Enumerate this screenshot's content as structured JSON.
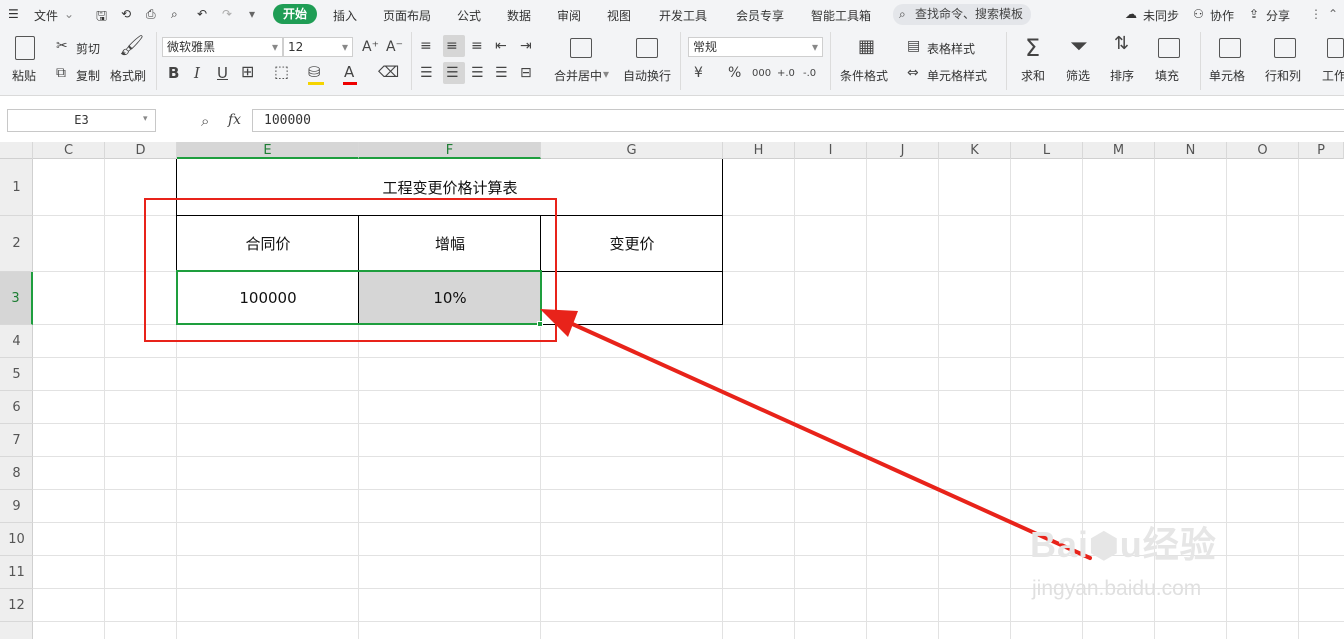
{
  "menubar": {
    "file_label": "文件",
    "tabs": [
      "开始",
      "插入",
      "页面布局",
      "公式",
      "数据",
      "审阅",
      "视图",
      "开发工具",
      "会员专享",
      "智能工具箱"
    ],
    "search_placeholder": "查找命令、搜索模板",
    "sync": "未同步",
    "collab": "协作",
    "share": "分享"
  },
  "ribbon": {
    "paste": "粘贴",
    "cut": "剪切",
    "copy": "复制",
    "format_painter": "格式刷",
    "font_name": "微软雅黑",
    "font_size": "12",
    "bold": "B",
    "italic": "I",
    "underline": "U",
    "merge_center": "合并居中",
    "wrap_text": "自动换行",
    "number_format": "常规",
    "currency": "¥",
    "percent": "%",
    "thousands": "000",
    "inc_decimal": "+.0",
    "dec_decimal": "-.0",
    "cond_format": "条件格式",
    "table_style": "表格样式",
    "cell_style": "单元格样式",
    "sum": "求和",
    "filter": "筛选",
    "sort": "排序",
    "fill": "填充",
    "cell": "单元格",
    "row_col": "行和列",
    "worksheet": "工作"
  },
  "formula_bar": {
    "name_box": "E3",
    "fx": "fx",
    "value": "100000"
  },
  "columns": [
    "C",
    "D",
    "E",
    "F",
    "G",
    "H",
    "I",
    "J",
    "K",
    "L",
    "M",
    "N",
    "O",
    "P"
  ],
  "rows": [
    "1",
    "2",
    "3",
    "4",
    "5",
    "6",
    "7",
    "8",
    "9",
    "10",
    "11",
    "12"
  ],
  "sheet": {
    "title": "工程变更价格计算表",
    "header_contract": "合同价",
    "header_increase": "增幅",
    "header_changed": "变更价",
    "contract_price": "100000",
    "increase_rate": "10%",
    "changed_price": ""
  },
  "watermark": "Baidu经验 jingyan.baidu.com",
  "colors": {
    "accent_green": "#1f9d55",
    "annotation_red": "#e8231a",
    "selection_gray": "#d6d6d6"
  }
}
